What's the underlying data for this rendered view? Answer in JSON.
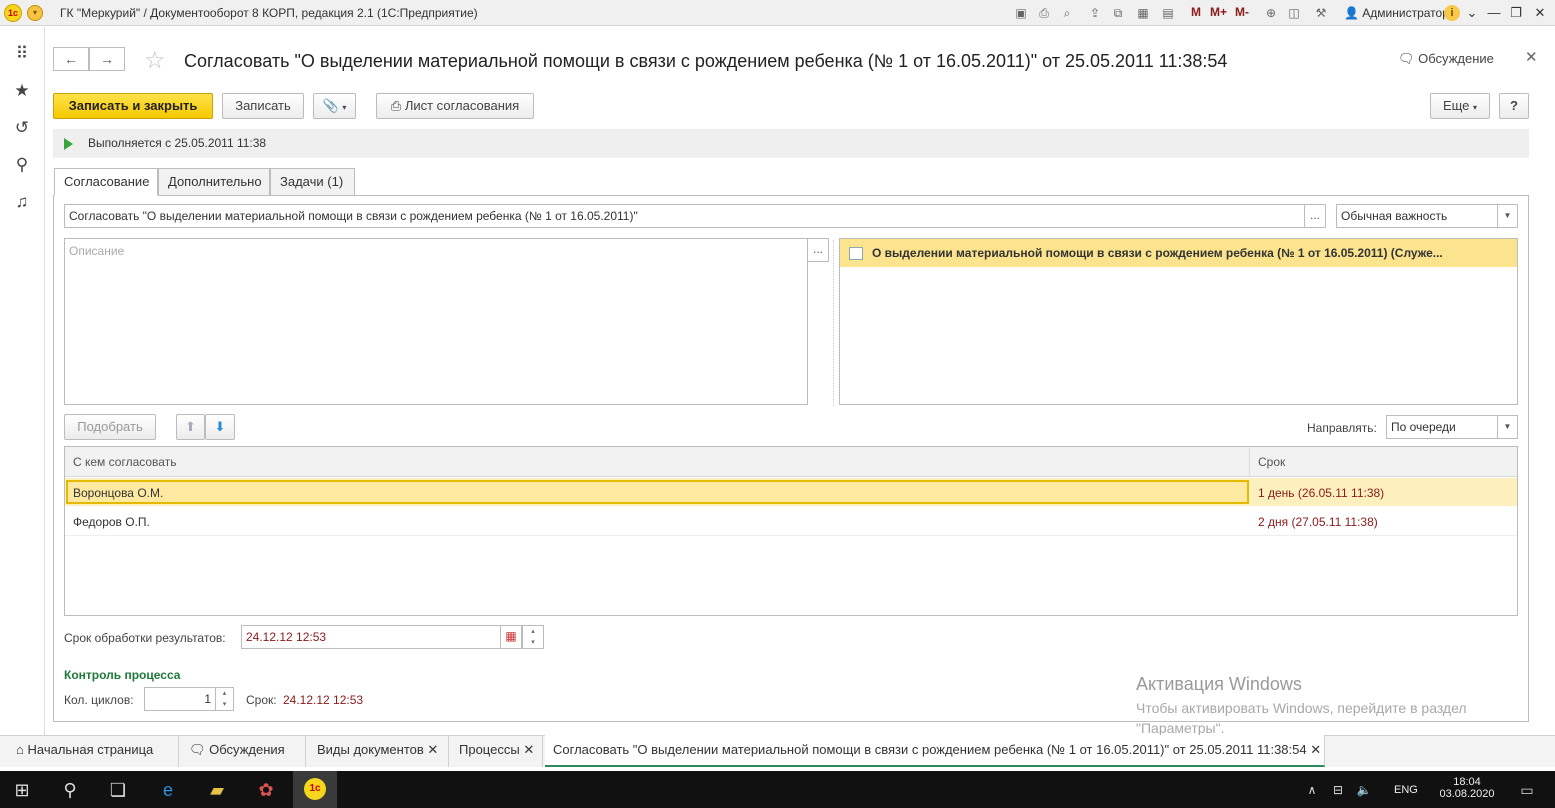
{
  "window": {
    "title": "ГК \"Меркурий\" / Документооборот 8 КОРП, редакция 2.1  (1С:Предприятие)",
    "user": "Администратор",
    "m_buttons": [
      "M",
      "M+",
      "M-"
    ]
  },
  "header": {
    "title": "Согласовать \"О выделении материальной помощи в связи с рождением ребенка (№ 1 от 16.05.2011)\" от 25.05.2011 11:38:54",
    "discussion_label": "Обсуждение"
  },
  "toolbar": {
    "save_close": "Записать и закрыть",
    "save": "Записать",
    "approval_sheet": "Лист согласования",
    "more": "Еще",
    "help": "?"
  },
  "status": {
    "text": "Выполняется с 25.05.2011 11:38"
  },
  "tabs": [
    {
      "label": "Согласование"
    },
    {
      "label": "Дополнительно"
    },
    {
      "label": "Задачи (1)"
    }
  ],
  "form": {
    "subject": "Согласовать \"О выделении материальной помощи в связи с рождением ребенка (№ 1 от 16.05.2011)\"",
    "importance": "Обычная важность",
    "description_placeholder": "Описание",
    "attached_doc": "О выделении материальной помощи в связи с рождением ребенка (№ 1 от 16.05.2011) (Служе...",
    "pick_button": "Подобрать",
    "direct_label": "Направлять:",
    "direct_value": "По очереди",
    "table": {
      "columns": [
        "С кем согласовать",
        "Срок"
      ],
      "rows": [
        {
          "who": "Воронцова О.М.",
          "term": "1 день (26.05.11 11:38)"
        },
        {
          "who": "Федоров О.П.",
          "term": "2 дня (27.05.11 11:38)"
        }
      ]
    },
    "results_deadline_label": "Срок обработки результатов:",
    "results_deadline_value": "24.12.12 12:53",
    "process_control_heading": "Контроль процесса",
    "cycles_label": "Кол. циклов:",
    "cycles_value": "1",
    "term_label": "Срок:",
    "term_value": "24.12.12 12:53"
  },
  "watermark": {
    "line1": "Активация Windows",
    "line2": "Чтобы активировать Windows, перейдите в раздел \"Параметры\"."
  },
  "bottom_tabs": [
    {
      "label": "Начальная страница"
    },
    {
      "label": "Обсуждения"
    },
    {
      "label": "Виды документов"
    },
    {
      "label": "Процессы"
    },
    {
      "label": "Согласовать \"О выделении материальной помощи в связи с рождением ребенка (№ 1 от 16.05.2011)\" от 25.05.2011 11:38:54"
    }
  ],
  "taskbar": {
    "lang": "ENG",
    "time": "18:04",
    "date": "03.08.2020"
  },
  "colors": {
    "primary_button": "#f6c800",
    "selected_row": "#fde9a0",
    "deadline_red": "#8b1a1a",
    "section_green": "#1f7a3a"
  }
}
